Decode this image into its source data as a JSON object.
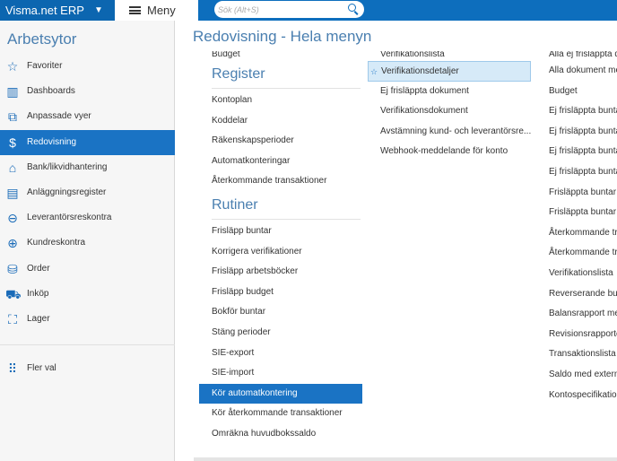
{
  "topbar": {
    "brand": "Visma.net ERP",
    "brand_caret": "▼",
    "menu_label": "Meny",
    "search_placeholder": "Sök (Alt+S)"
  },
  "sidebar": {
    "title": "Arbetsytor",
    "items": [
      {
        "label": "Favoriter",
        "icon": "☆"
      },
      {
        "label": "Dashboards",
        "icon": "▥"
      },
      {
        "label": "Anpassade vyer",
        "icon": "⧉"
      },
      {
        "label": "Redovisning",
        "icon": "$"
      },
      {
        "label": "Bank/likvidhantering",
        "icon": "⌂"
      },
      {
        "label": "Anläggningsregister",
        "icon": "▤"
      },
      {
        "label": "Leverantörsreskontra",
        "icon": "⊖"
      },
      {
        "label": "Kundreskontra",
        "icon": "⊕"
      },
      {
        "label": "Order",
        "icon": "⛁"
      },
      {
        "label": "Inköp",
        "icon": "⛟"
      },
      {
        "label": "Lager",
        "icon": "⛶"
      }
    ],
    "more": {
      "label": "Fler val",
      "icon": "⠿"
    }
  },
  "main": {
    "title": "Redovisning - Hela menyn",
    "col1": {
      "top_cut": "Budget",
      "sections": [
        {
          "title": "Register",
          "items": [
            "Kontoplan",
            "Koddelar",
            "Räkenskapsperioder",
            "Automatkonteringar",
            "Återkommande transaktioner"
          ]
        },
        {
          "title": "Rutiner",
          "items": [
            "Frisläpp buntar",
            "Korrigera verifikationer",
            "Frisläpp arbetsböcker",
            "Frisläpp budget",
            "Bokför buntar",
            "Stäng perioder",
            "SIE-export",
            "SIE-import",
            "Kör automatkontering",
            "Kör återkommande transaktioner",
            "Omräkna huvudbokssaldo"
          ]
        }
      ]
    },
    "col2": {
      "top_cut": "Verifikationslista",
      "items": [
        "Verifikationsdetaljer",
        "Ej frisläppta dokument",
        "Verifikationsdokument",
        "Avstämning kund- och leverantörsre...",
        "Webhook-meddelande för konto"
      ],
      "fav_star": "☆"
    },
    "col3": {
      "top_cut": "Alla ej frisläppta d",
      "items": [
        "Alla dokument me",
        "Budget",
        "Ej frisläppta bunta",
        "Ej frisläppta bunta",
        "Ej frisläppta bunta",
        "Ej frisläppta bunta",
        "Frisläppta buntar",
        "Frisläppta buntar",
        "Återkommande tr",
        "Återkommande tr",
        "Verifikationslista",
        "Reverserande bun",
        "Balansrapport me",
        "Revisionsrapporte",
        "Transaktionslista",
        "Saldo med extern",
        "Kontospecifikatio"
      ]
    }
  }
}
